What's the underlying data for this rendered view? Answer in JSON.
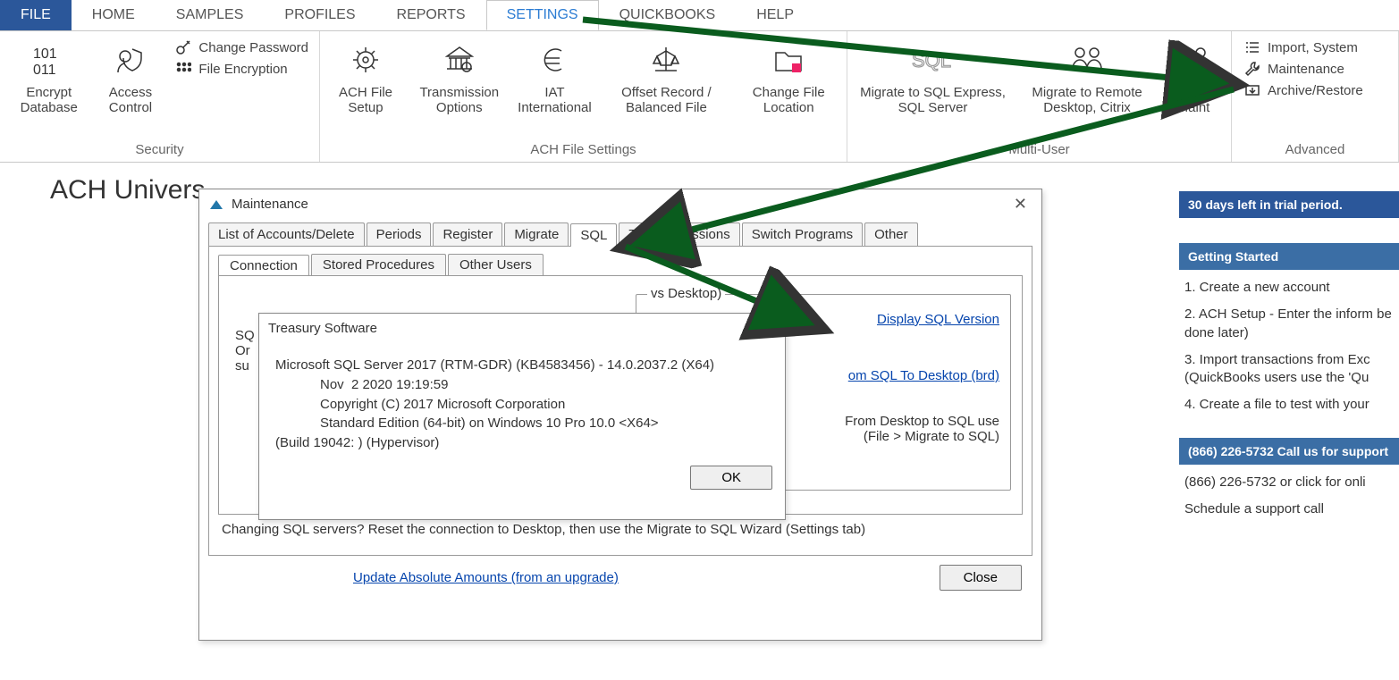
{
  "menu": {
    "file": "FILE",
    "home": "HOME",
    "samples": "SAMPLES",
    "profiles": "PROFILES",
    "reports": "REPORTS",
    "settings": "SETTINGS",
    "quickbooks": "QUICKBOOKS",
    "help": "HELP"
  },
  "ribbon": {
    "security": {
      "encrypt": "Encrypt Database",
      "access": "Access Control",
      "changepw": "Change Password",
      "fileenc": "File Encryption",
      "label": "Security"
    },
    "ach": {
      "achfile": "ACH File Setup",
      "transmission": "Transmission Options",
      "iat": "IAT International",
      "offset": "Offset Record / Balanced File",
      "changeloc": "Change File Location",
      "label": "ACH File Settings"
    },
    "multi": {
      "migratesql": "Migrate to SQL Express, SQL Server",
      "migrateremote": "Migrate to Remote Desktop, Citrix",
      "citrix": "Citrix Maint",
      "label": "Multi-User"
    },
    "advanced": {
      "import": "Import, System",
      "maint": "Maintenance",
      "archive": "Archive/Restore",
      "label": "Advanced"
    }
  },
  "page_title": "ACH Univers",
  "maint_modal": {
    "title": "Maintenance",
    "tabs": {
      "list": "List of Accounts/Delete",
      "periods": "Periods",
      "register": "Register",
      "migrate": "Migrate",
      "sql": "SQL",
      "test": "Test Permissions",
      "switch": "Switch Programs",
      "other": "Other"
    },
    "subtabs": {
      "conn": "Connection",
      "stored": "Stored Procedures",
      "otheru": "Other Users"
    },
    "sq_prefix": "SQ",
    "or": "Or",
    "su": "su",
    "display_link": "Display SQL Version",
    "fieldset_legend": "vs Desktop)",
    "sql_to_desktop": "om SQL To Desktop (brd)",
    "note1": "From Desktop to SQL use",
    "note2": "(File > Migrate to SQL)",
    "hint": "Changing SQL servers?  Reset the connection to Desktop, then use the Migrate to SQL Wizard (Settings tab)",
    "update_link": "Update Absolute Amounts (from an upgrade)",
    "close": "Close"
  },
  "msgbox": {
    "title": "Treasury Software",
    "body": "Microsoft SQL Server 2017 (RTM-GDR) (KB4583456) - 14.0.2037.2 (X64)\n            Nov  2 2020 19:19:59\n            Copyright (C) 2017 Microsoft Corporation\n            Standard Edition (64-bit) on Windows 10 Pro 10.0 <X64>\n(Build 19042: ) (Hypervisor)",
    "ok": "OK"
  },
  "side": {
    "trial": "30 days left in trial period.",
    "getting": "Getting Started",
    "s1": "1. Create a new account",
    "s2": "2. ACH Setup - Enter the inform be done later)",
    "s3": "3. Import transactions from Exc (QuickBooks users use the 'Qu",
    "s4": "4. Create a file to test with your",
    "call_hdr": "(866) 226-5732 Call us for support",
    "call1": "(866) 226-5732 or click for onli",
    "call2": "Schedule a support call"
  }
}
